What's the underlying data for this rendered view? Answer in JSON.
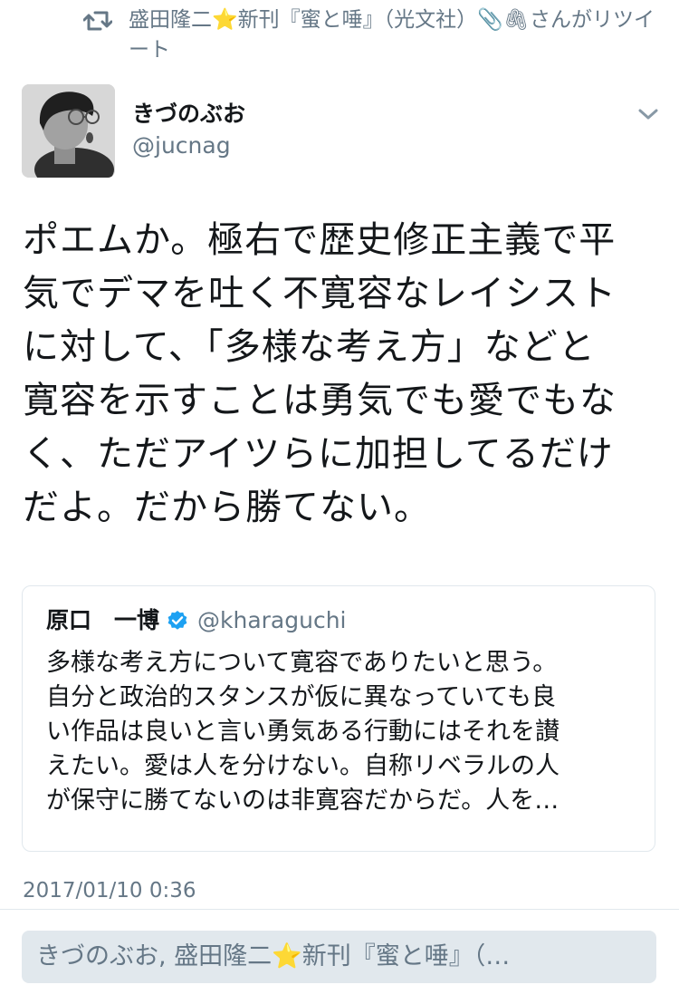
{
  "retweet": {
    "icon": "retweet-icon",
    "text": "盛田隆二⭐新刊『蜜と唾』（光文社）📎🖇さんがリツイート"
  },
  "author": {
    "avatar": "avatar",
    "display_name": "きづのぶお",
    "handle": "@jucnag",
    "menu_icon": "chevron-down-icon"
  },
  "tweet": {
    "lines": [
      "ポエムか。極右で歴史修正主義で平",
      "気でデマを吐く不寛容なレイシスト",
      "に対して、「多様な考え方」などと",
      "寛容を示すことは勇気でも愛でもな",
      "く、ただアイツらに加担してるだけ",
      "だよ。だから勝てない。"
    ]
  },
  "quoted_tweet": {
    "display_name": "原口　一博",
    "verified_icon": "verified-badge-icon",
    "handle": "@kharaguchi",
    "lines": [
      "多様な考え方について寛容でありたいと思う。",
      "自分と政治的スタンスが仮に異なっていても良",
      "い作品は良いと言い勇気ある行動にはそれを讃",
      "えたい。愛は人を分けない。自称リベラルの人",
      "が保守に勝てないのは非寛容だからだ。人を…"
    ]
  },
  "timestamp": "2017/01/10 0:36",
  "reply": {
    "placeholder_text": "きづのぶお, 盛田隆二⭐新刊『蜜と唾』（…"
  },
  "colors": {
    "text_primary": "#14171a",
    "text_secondary": "#657786",
    "border": "#e1e8ed",
    "verified": "#1da1f2",
    "star": "#f6c026"
  }
}
